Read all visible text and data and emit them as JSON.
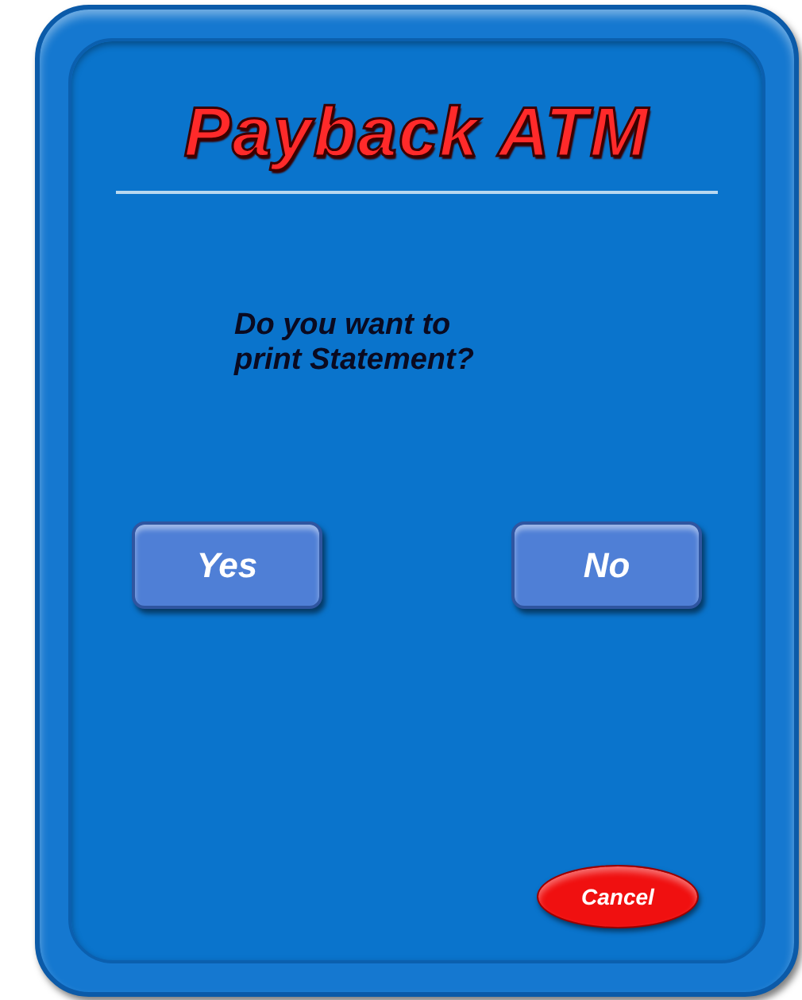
{
  "title": "Payback ATM",
  "prompt": {
    "lines": [
      "Do you want to",
      "print Statement?"
    ]
  },
  "buttons": [
    {
      "label": "Yes",
      "kind": "choice"
    },
    {
      "label": "No",
      "kind": "choice"
    },
    {
      "label": "Cancel",
      "kind": "cancel"
    }
  ]
}
